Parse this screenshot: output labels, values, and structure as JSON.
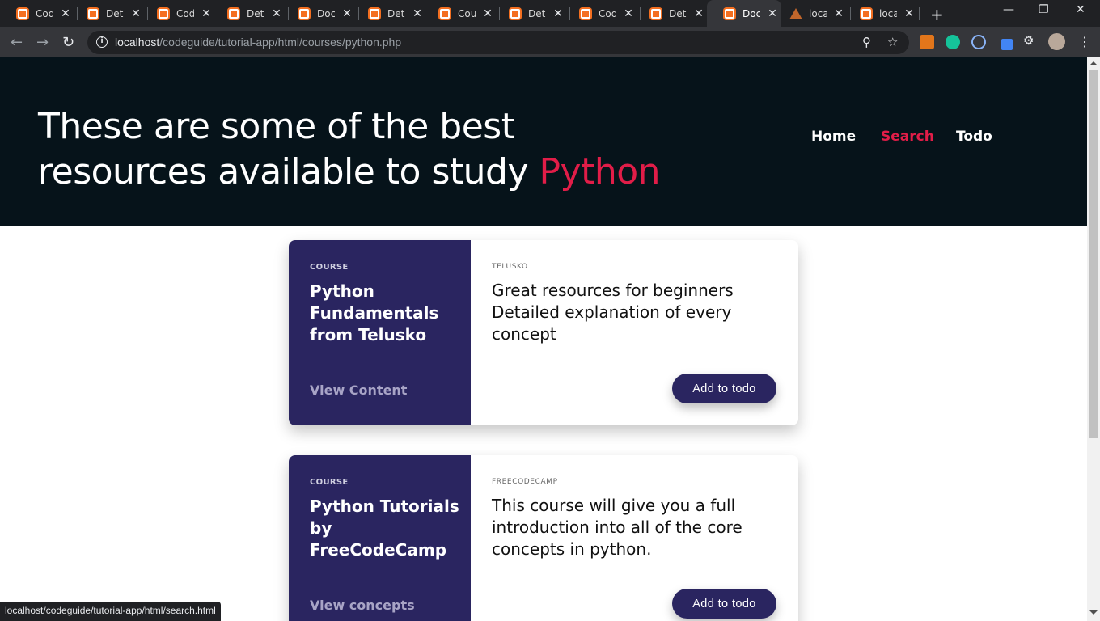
{
  "browser": {
    "tabs": [
      {
        "title": "Code",
        "icon": "xampp-icon"
      },
      {
        "title": "Deta",
        "icon": "xampp-icon"
      },
      {
        "title": "Code",
        "icon": "xampp-icon"
      },
      {
        "title": "Deta",
        "icon": "xampp-icon"
      },
      {
        "title": "Doc",
        "icon": "xampp-icon"
      },
      {
        "title": "Deta",
        "icon": "xampp-icon"
      },
      {
        "title": "Cou",
        "icon": "xampp-icon"
      },
      {
        "title": "Deta",
        "icon": "xampp-icon"
      },
      {
        "title": "Code",
        "icon": "xampp-icon"
      },
      {
        "title": "Deta",
        "icon": "xampp-icon"
      },
      {
        "title": "Doc",
        "icon": "xampp-icon",
        "active": true
      },
      {
        "title": "loca",
        "icon": "warning-icon"
      },
      {
        "title": "loca",
        "icon": "xampp-icon"
      }
    ],
    "url_host": "localhost",
    "url_path": "/codeguide/tutorial-app/html/courses/python.php",
    "status_url": "localhost/codeguide/tutorial-app/html/search.html"
  },
  "page": {
    "heading_line1": "These are some of the best",
    "heading_line2": "resources available to study",
    "heading_accent": "Python",
    "nav": {
      "home": "Home",
      "search": "Search",
      "todo": "Todo"
    }
  },
  "courses": [
    {
      "tag": "COURSE",
      "name": "Python Fundamentals from Telusko",
      "link": "View Content",
      "author": "TELUSKO",
      "description": "Great resources for beginners Detailed explanation of every concept",
      "button": "Add to todo"
    },
    {
      "tag": "COURSE",
      "name": "Python Tutorials by FreeCodeCamp",
      "link": "View concepts",
      "author": "FREECODECAMP",
      "description": "This course will give you a full introduction into all of the core concepts in python.",
      "button": "Add to todo"
    }
  ],
  "colors": {
    "hero_bg": "#06131a",
    "accent": "#e11d48",
    "card_side": "#2a2560"
  }
}
